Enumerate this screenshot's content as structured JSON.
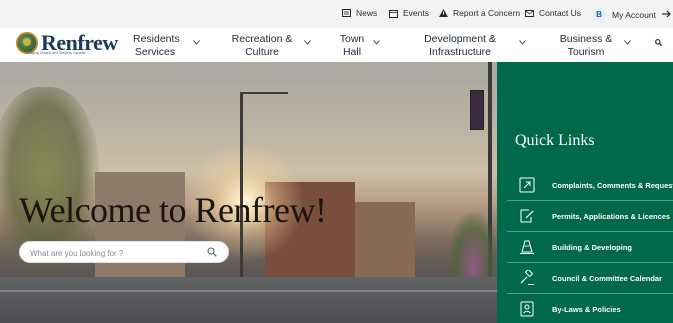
{
  "utility_bar": {
    "news": "News",
    "events": "Events",
    "report": "Report a Concern",
    "contact": "Contact Us",
    "account": "My Account",
    "account_badge": "B"
  },
  "logo": {
    "name": "Renfrew",
    "tagline": "Bridging Ontario and Western Canada"
  },
  "nav": {
    "items": [
      {
        "line1": "Residents",
        "line2": "Services"
      },
      {
        "line1": "Recreation &",
        "line2": "Culture"
      },
      {
        "line1": "Town",
        "line2": "Hall"
      },
      {
        "line1": "Development &",
        "line2": "Infrastructure"
      },
      {
        "line1": "Business &",
        "line2": "Tourism"
      }
    ]
  },
  "hero": {
    "headline": "Welcome to Renfrew!",
    "search_placeholder": "What are you looking for ?"
  },
  "quick_links": {
    "title": "Quick Links",
    "items": [
      {
        "label": "Complaints, Comments & Requests",
        "icon": "arrow-box-icon"
      },
      {
        "label": "Permits, Applications & Licences",
        "icon": "edit-document-icon"
      },
      {
        "label": "Building & Developing",
        "icon": "cone-icon"
      },
      {
        "label": "Council & Committee Calendar",
        "icon": "gavel-icon"
      },
      {
        "label": "By-Laws & Policies",
        "icon": "badge-person-icon"
      }
    ]
  },
  "colors": {
    "quick_links_bg": "#00694a",
    "logo_blue": "#1d3a5c",
    "utility_bg": "#f3f3f3"
  }
}
